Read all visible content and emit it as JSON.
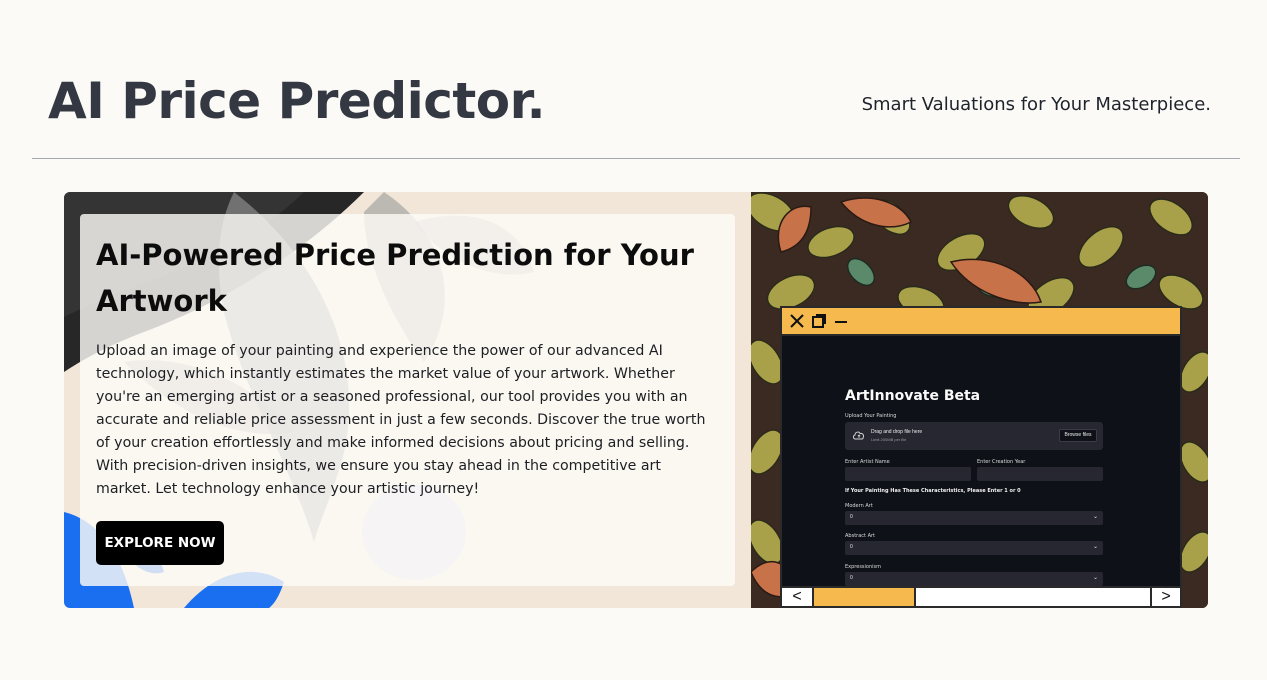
{
  "header": {
    "title": "AI Price Predictor.",
    "tagline": "Smart Valuations for Your Masterpiece."
  },
  "hero": {
    "heading": "AI-Powered Price Prediction for Your Artwork",
    "description": "Upload an image of your painting and experience the power of our advanced AI technology, which instantly estimates the market value of your artwork. Whether you're an emerging artist or a seasoned professional, our tool provides you with an accurate and reliable price assessment in just a few seconds. Discover the true worth of your creation effortlessly and make informed decisions about pricing and selling. With precision-driven insights, we ensure you stay ahead in the competitive art market. Let technology enhance your artistic journey!",
    "cta_label": "EXPLORE NOW"
  },
  "preview_window": {
    "app_title": "ArtInnovate Beta",
    "upload_label": "Upload Your Painting",
    "dropzone_text": "Drag and drop file here",
    "dropzone_limit": "Limit 200MB per file",
    "browse_label": "Browse files",
    "artist_label": "Enter Artist Name",
    "year_label": "Enter Creation Year",
    "characteristics_prompt": "If Your Painting Has These Characteristics, Please Enter 1 or 0",
    "selects": [
      {
        "label": "Modern Art",
        "value": "0"
      },
      {
        "label": "Abstract Art",
        "value": "0"
      },
      {
        "label": "Expressionism",
        "value": "0"
      }
    ],
    "scroll_left": "<",
    "scroll_right": ">"
  },
  "colors": {
    "window_bar": "#f6b94e",
    "app_bg": "#0e1117",
    "accent_blue": "#1a6ff0"
  }
}
